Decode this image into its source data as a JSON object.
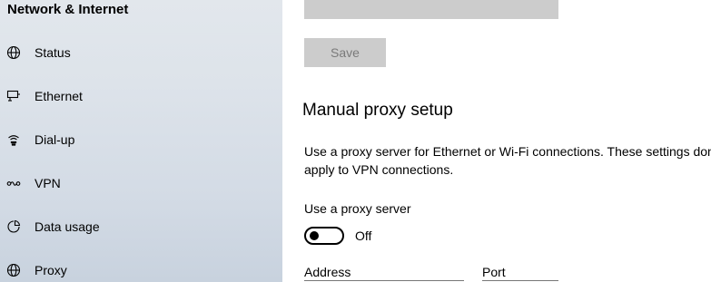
{
  "sidebar": {
    "title": "Network & Internet",
    "items": [
      {
        "label": "Status",
        "icon": "globe-icon"
      },
      {
        "label": "Ethernet",
        "icon": "ethernet-icon"
      },
      {
        "label": "Dial-up",
        "icon": "dialup-icon"
      },
      {
        "label": "VPN",
        "icon": "vpn-icon"
      },
      {
        "label": "Data usage",
        "icon": "data-usage-icon"
      },
      {
        "label": "Proxy",
        "icon": "globe-icon"
      }
    ]
  },
  "main": {
    "save_label": "Save",
    "section_title": "Manual proxy setup",
    "description": "Use a proxy server for Ethernet or Wi-Fi connections. These settings don’t apply to VPN connections.",
    "proxy_toggle": {
      "label": "Use a proxy server",
      "state": "Off"
    },
    "address_label": "Address",
    "port_label": "Port"
  },
  "colors": {
    "sidebar_background": "#dde3ea",
    "disabled_control": "#cccccc",
    "disabled_text": "#7a7a7a"
  }
}
